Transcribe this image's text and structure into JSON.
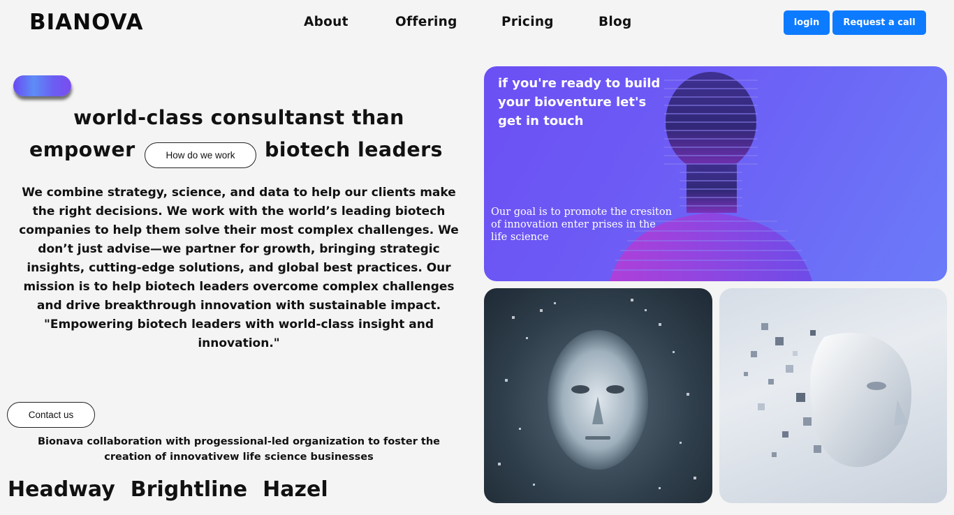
{
  "header": {
    "logo": "BIANOVA",
    "nav": [
      {
        "label": "About"
      },
      {
        "label": "Offering"
      },
      {
        "label": "Pricing"
      },
      {
        "label": "Blog"
      }
    ],
    "login_label": "login",
    "request_call_label": "Request a call"
  },
  "hero": {
    "headline_line1": "world-class consultanst than",
    "headline_line2_start": "empower",
    "how_we_work_label": "How do we work",
    "headline_line2_end": "biotech leaders",
    "paragraph": "We combine strategy, science, and data to help our clients make the right decisions. We work with the world’s leading biotech companies to help them solve their most complex challenges. We don’t just advise—we partner for growth, bringing strategic insights, cutting-edge solutions, and global best practices. Our mission is to help biotech leaders overcome complex challenges and drive breakthrough innovation with sustainable impact.",
    "quote": "\"Empowering biotech leaders with world-class insight and innovation.\"",
    "contact_label": "Contact us",
    "collaboration_text": "Bionava collaboration with progessional-led organization to foster the creation of innovativew life science businesses",
    "brands": [
      "Headway",
      "Brightline",
      "Hazel"
    ]
  },
  "cards": {
    "hero_card": {
      "title": "if you're ready to build your bioventure let's get in touch",
      "subtitle": "Our goal is to promote the cresiton of innovation enter prises in the life science"
    }
  },
  "colors": {
    "accent_blue": "#0d7bff",
    "hero_card_purple": "#6b5cf5",
    "page_background": "#f4f4f4"
  }
}
